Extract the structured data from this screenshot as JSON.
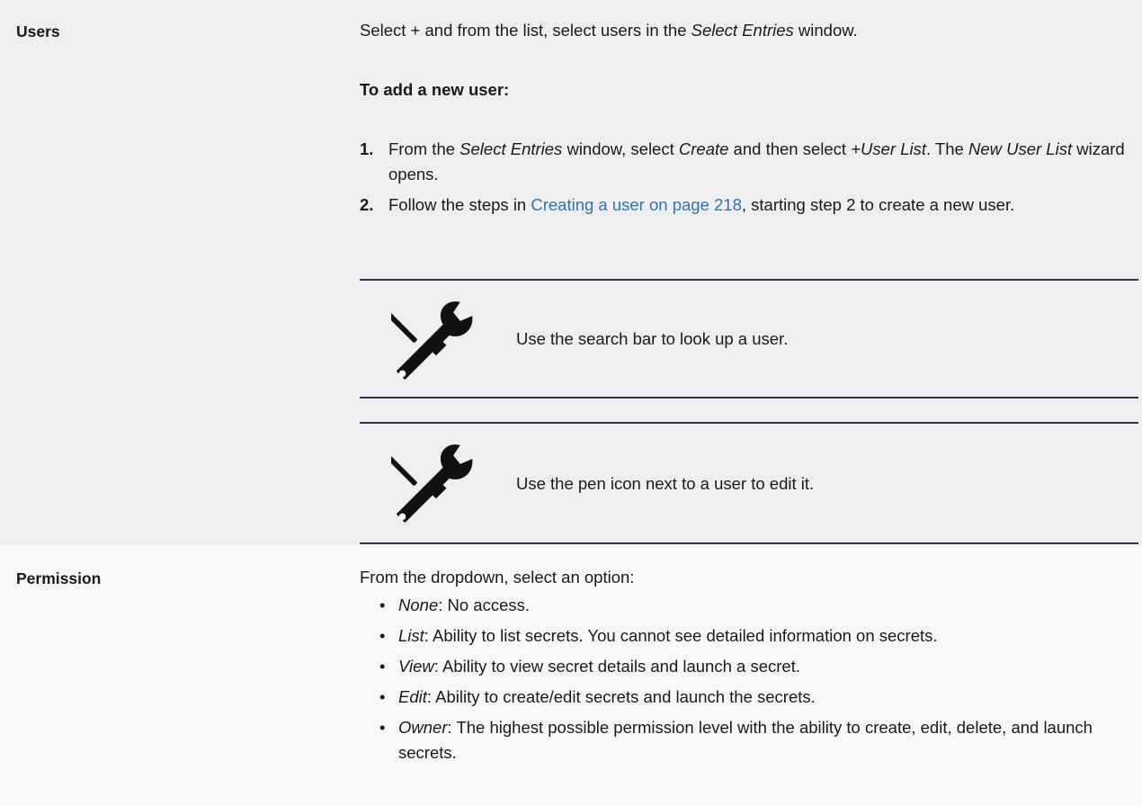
{
  "users_row": {
    "label": "Users",
    "intro": {
      "a": "Select + and from the list, select users in the ",
      "b": "Select Entries",
      "c": " window."
    },
    "subheading": "To add a new user:",
    "steps": [
      {
        "num": "1.",
        "a": "From the ",
        "b": "Select Entries",
        "c": " window, select ",
        "d": "Create",
        "e": " and then select ",
        "f": "+User List",
        "g": ". The ",
        "h": "New User List",
        "i": " wizard opens."
      },
      {
        "num": "2.",
        "a": "Follow the steps in ",
        "link": "Creating a user on page 218",
        "b": ", starting step 2 to create a new user."
      }
    ],
    "notes": [
      {
        "icon": "tools-icon",
        "text": "Use the search bar to look up a user."
      },
      {
        "icon": "tools-icon",
        "text": "Use the pen icon next to a user to edit it."
      }
    ]
  },
  "permission_row": {
    "label": "Permission",
    "intro": "From the dropdown, select an option:",
    "options": [
      {
        "name": "None",
        "desc": ": No access."
      },
      {
        "name": "List",
        "desc": ": Ability to list secrets. You cannot see detailed information on secrets."
      },
      {
        "name": "View",
        "desc": ": Ability to view secret details and launch a secret."
      },
      {
        "name": "Edit",
        "desc": ": Ability to create/edit secrets and launch the secrets."
      },
      {
        "name": "Owner",
        "desc": ": The highest possible permission level with the ability to create, edit, delete, and launch secrets."
      }
    ]
  },
  "colors": {
    "users_row_bg": "#efefef",
    "permission_row_bg": "#f8f8f8",
    "link": "#2e74b5",
    "note_rule": "#2b3a4a"
  }
}
